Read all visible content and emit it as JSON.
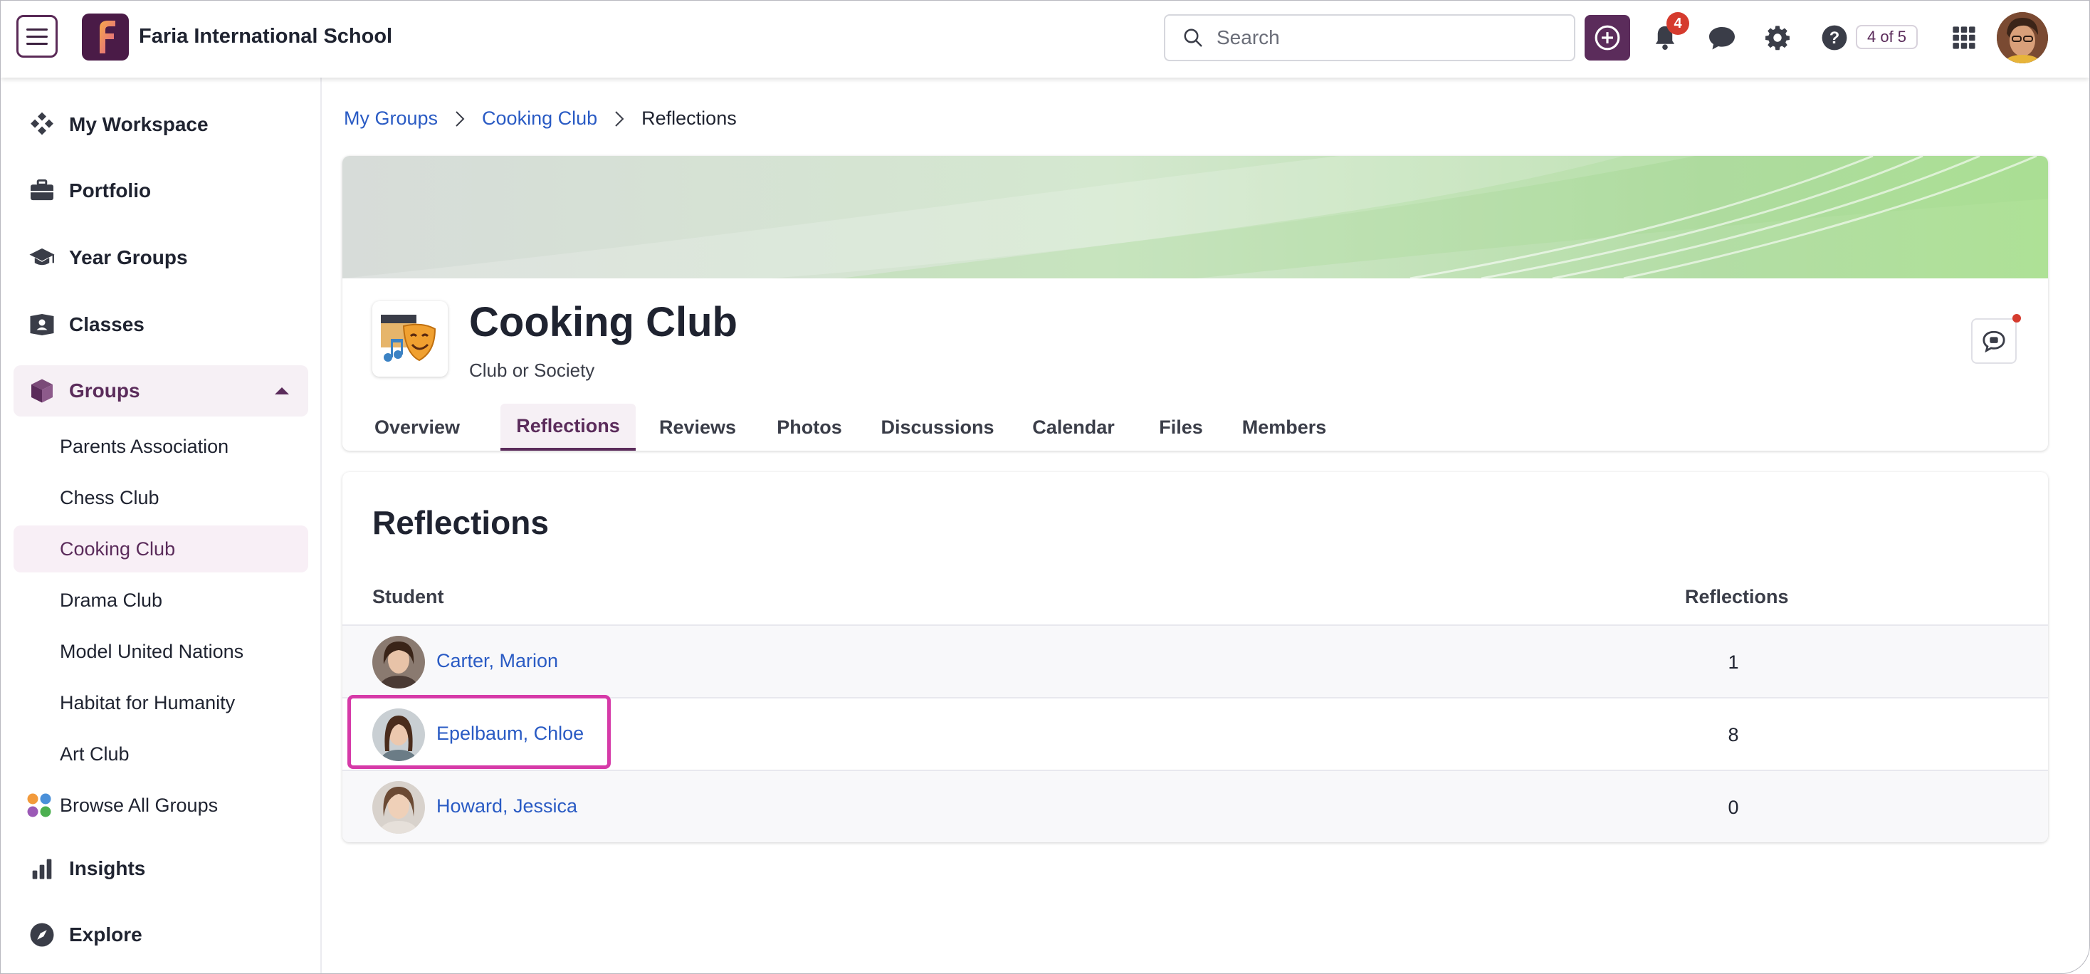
{
  "header": {
    "school_name": "Faria International School",
    "search_placeholder": "Search",
    "notification_count": "4",
    "pager": "4 of 5",
    "brand_color": "#5b2c5b"
  },
  "sidebar": {
    "items": [
      {
        "label": "My Workspace",
        "icon": "workspace-icon"
      },
      {
        "label": "Portfolio",
        "icon": "briefcase-icon"
      },
      {
        "label": "Year Groups",
        "icon": "graduation-cap-icon"
      },
      {
        "label": "Classes",
        "icon": "classes-icon"
      },
      {
        "label": "Groups",
        "icon": "cube-icon"
      }
    ],
    "groups": [
      "Parents Association",
      "Chess Club",
      "Cooking Club",
      "Drama Club",
      "Model United Nations",
      "Habitat for Humanity",
      "Art Club"
    ],
    "browse_all": "Browse All Groups",
    "insights": "Insights",
    "explore": "Explore"
  },
  "breadcrumb": [
    "My Groups",
    "Cooking Club",
    "Reflections"
  ],
  "group": {
    "title": "Cooking Club",
    "subtitle": "Club or Society",
    "tabs": [
      "Overview",
      "Reflections",
      "Reviews",
      "Photos",
      "Discussions",
      "Calendar",
      "Files",
      "Members"
    ],
    "active_tab": "Reflections"
  },
  "reflections": {
    "title": "Reflections",
    "columns": [
      "Student",
      "Reflections"
    ],
    "rows": [
      {
        "name": "Carter, Marion",
        "count": "1"
      },
      {
        "name": "Epelbaum, Chloe",
        "count": "8"
      },
      {
        "name": "Howard, Jessica",
        "count": "0"
      }
    ]
  }
}
